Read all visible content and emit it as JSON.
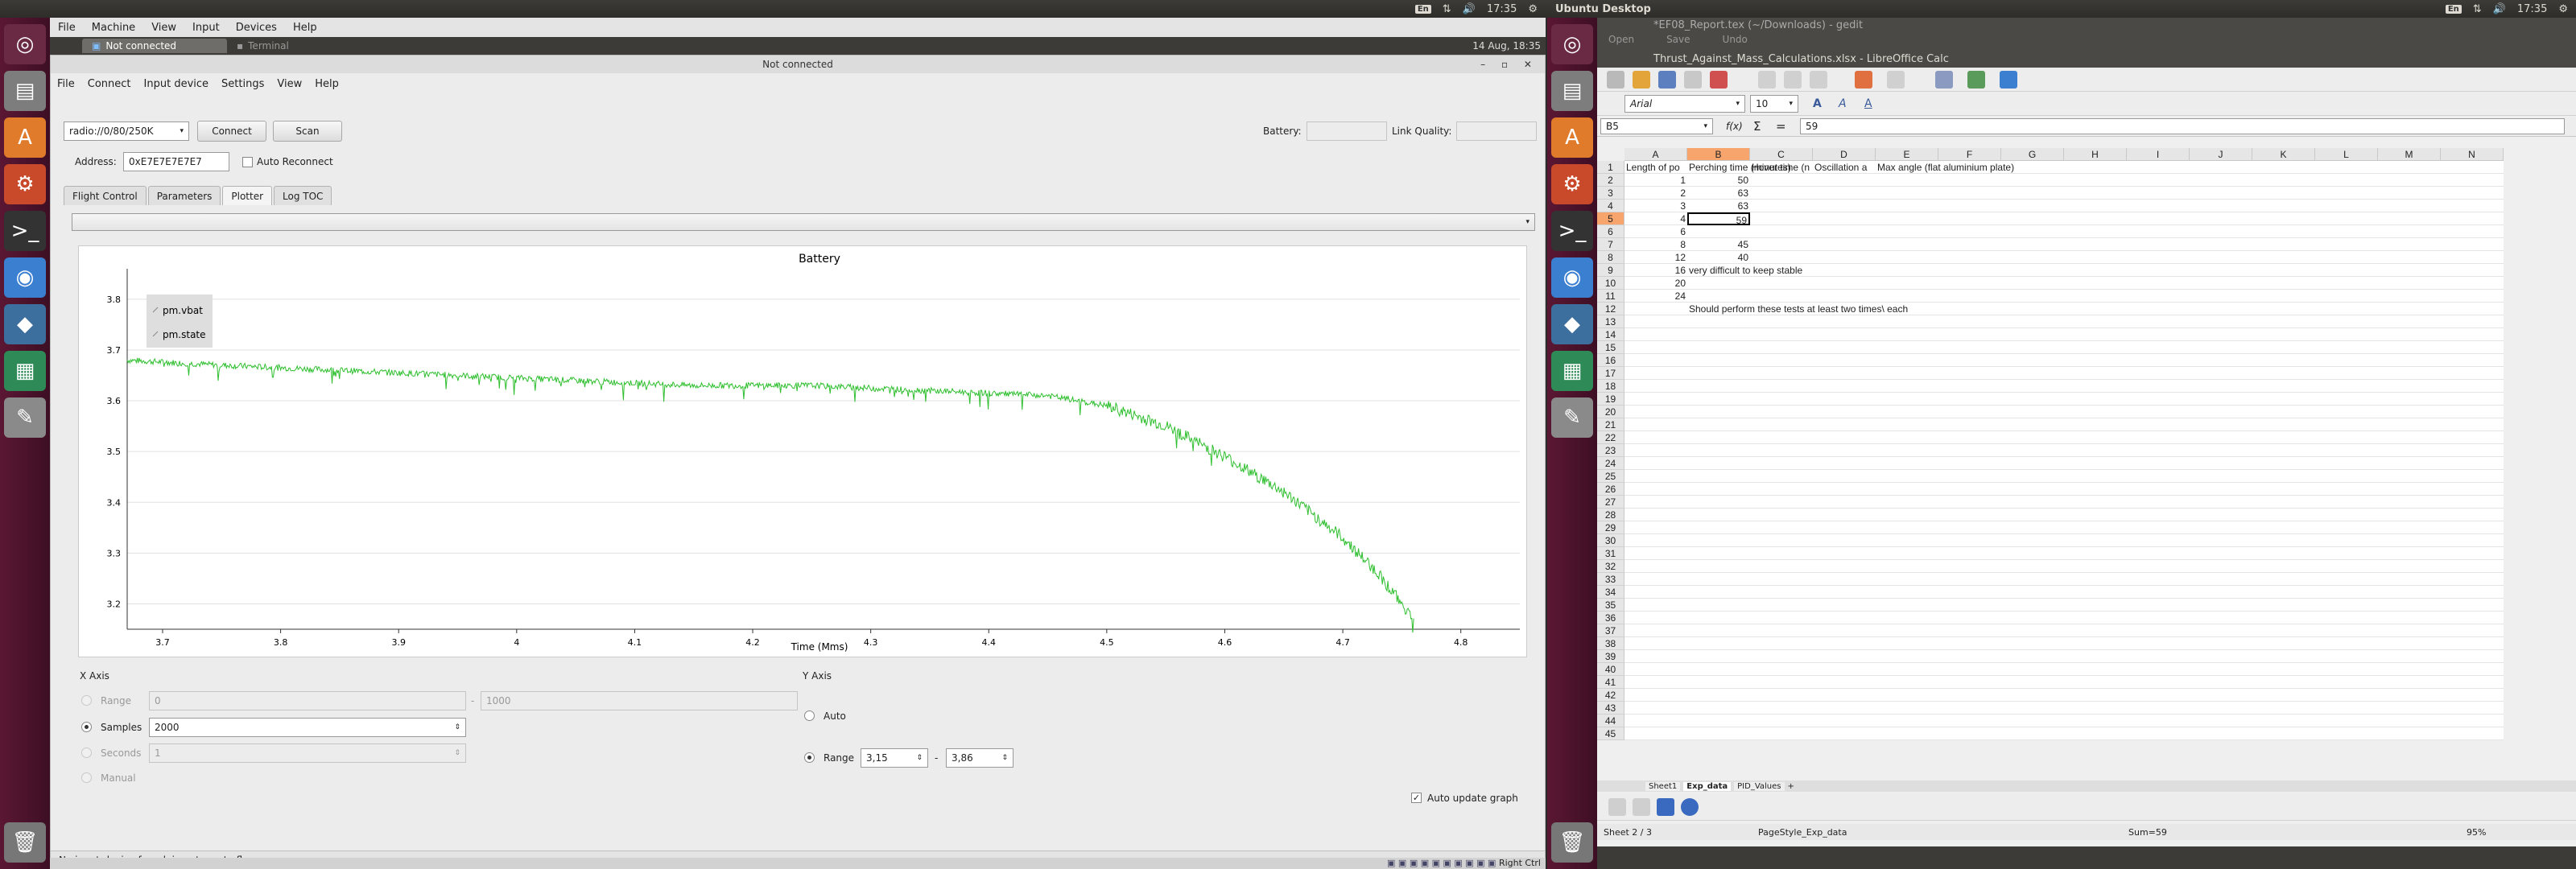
{
  "left_panel": {
    "title": "",
    "time": "17:35",
    "kb": "En"
  },
  "right_panel": {
    "title": "Ubuntu Desktop",
    "time": "17:35",
    "kb": "En"
  },
  "vbox": {
    "menu": [
      "File",
      "Machine",
      "View",
      "Input",
      "Devices",
      "Help"
    ],
    "tabs": [
      {
        "label": "Not connected"
      },
      {
        "label": "Terminal"
      }
    ],
    "clock": "14 Aug, 18:35",
    "statusbar_right": "Right Ctrl"
  },
  "app": {
    "title": "Not connected",
    "menu": [
      "File",
      "Connect",
      "Input device",
      "Settings",
      "View",
      "Help"
    ],
    "uri": "radio://0/80/250K",
    "connect_label": "Connect",
    "scan_label": "Scan",
    "battery_label": "Battery:",
    "link_label": "Link Quality:",
    "address_label": "Address:",
    "address_value": "0xE7E7E7E7E7",
    "auto_reconnect": "Auto Reconnect",
    "tabs": [
      "Flight Control",
      "Parameters",
      "Plotter",
      "Log TOC"
    ],
    "active_tab": "Plotter",
    "status": "No input-device found, insert one to fly."
  },
  "plot": {
    "title": "Battery",
    "xlabel": "Time (Mms)",
    "legend": [
      "pm.vbat",
      "pm.state"
    ],
    "line_color": "#2fbf2f"
  },
  "chart_data": {
    "type": "line",
    "title": "Battery",
    "xlabel": "Time (Mms)",
    "ylabel": "",
    "xlim": [
      3.67,
      4.85
    ],
    "ylim": [
      3.15,
      3.86
    ],
    "x_ticks": [
      "3.7",
      "3.8",
      "3.9",
      "4",
      "4.1",
      "4.2",
      "4.3",
      "4.4",
      "4.5",
      "4.6",
      "4.7",
      "4.8"
    ],
    "y_ticks": [
      "3.2",
      "3.3",
      "3.4",
      "3.5",
      "3.6",
      "3.7",
      "3.8"
    ],
    "series": [
      {
        "name": "pm.vbat",
        "x": [
          3.67,
          3.75,
          3.85,
          3.95,
          4.05,
          4.15,
          4.25,
          4.35,
          4.45,
          4.5,
          4.55,
          4.6,
          4.65,
          4.7,
          4.73,
          4.76
        ],
        "y": [
          3.68,
          3.67,
          3.66,
          3.65,
          3.64,
          3.63,
          3.63,
          3.62,
          3.61,
          3.59,
          3.55,
          3.49,
          3.42,
          3.33,
          3.26,
          3.17
        ]
      },
      {
        "name": "pm.state",
        "x": [],
        "y": []
      }
    ],
    "legend_position": "top-left",
    "grid": true
  },
  "xaxis": {
    "group": "X Axis",
    "range_label": "Range",
    "range_from": "0",
    "range_to": "1000",
    "samples_label": "Samples",
    "samples_value": "2000",
    "seconds_label": "Seconds",
    "seconds_value": "1",
    "manual_label": "Manual"
  },
  "yaxis": {
    "group": "Y Axis",
    "auto_label": "Auto",
    "range_label": "Range",
    "range_from": "3,15",
    "range_to": "3,86",
    "auto_update": "Auto update graph"
  },
  "gedit": {
    "title": "*EF08_Report.tex (~/Downloads) - gedit",
    "open": "Open",
    "save": "Save",
    "undo": "Undo"
  },
  "calc": {
    "title": "Thrust_Against_Mass_Calculations.xlsx - LibreOffice Calc",
    "font": "Arial",
    "size": "10",
    "cellref": "B5",
    "formula": "59",
    "columns": [
      "A",
      "B",
      "C",
      "D",
      "E",
      "F",
      "G",
      "H",
      "I",
      "J",
      "K",
      "L",
      "M",
      "N"
    ],
    "rows": [
      [
        "Length of po",
        "Perching time (minutes)",
        "Hover time (n",
        "Oscillation a",
        "Max angle (flat aluminium plate)"
      ],
      [
        "1",
        "50",
        "",
        "",
        ""
      ],
      [
        "2",
        "63",
        "",
        "",
        ""
      ],
      [
        "3",
        "63",
        "",
        "",
        ""
      ],
      [
        "4",
        "59",
        "",
        "",
        ""
      ],
      [
        "6",
        "",
        "",
        "",
        ""
      ],
      [
        "8",
        "45",
        "",
        "",
        ""
      ],
      [
        "12",
        "40",
        "",
        "",
        ""
      ],
      [
        "16",
        "very difficult to keep stable",
        "",
        "",
        ""
      ],
      [
        "20",
        "",
        "",
        "",
        ""
      ],
      [
        "24",
        "",
        "",
        "",
        ""
      ],
      [
        "",
        "Should perform these tests at least two times\\ each",
        "",
        "",
        ""
      ]
    ],
    "sheets": [
      "Sheet1",
      "Exp_data",
      "PID_Values"
    ],
    "status_sheet": "Sheet 2 / 3",
    "pagestyle": "PageStyle_Exp_data",
    "sum": "Sum=59",
    "zoom": "95%"
  }
}
